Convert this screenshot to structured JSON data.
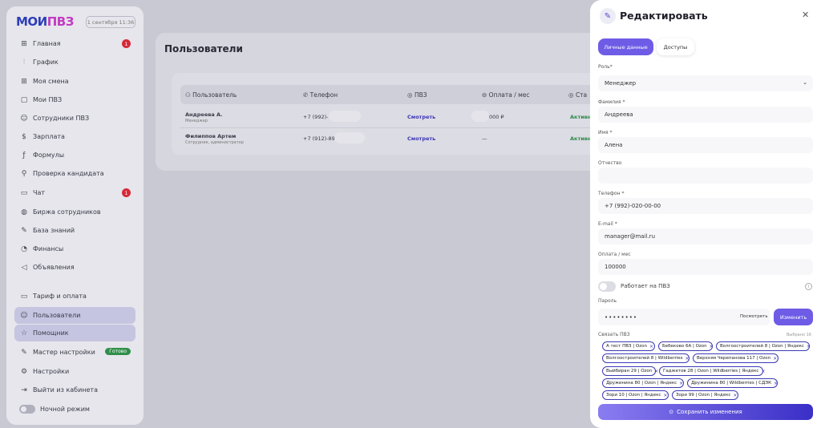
{
  "sidebar": {
    "logo_main": "МОИ",
    "logo_accent": "ПВЗ",
    "date": "1 сентября 11:36",
    "items": [
      {
        "label": "Главная",
        "icon": "grid-icon",
        "badge": "1"
      },
      {
        "label": "График",
        "icon": "chart-icon"
      },
      {
        "label": "Моя смена",
        "icon": "grid-icon"
      },
      {
        "label": "Мои ПВЗ",
        "icon": "box-icon"
      },
      {
        "label": "Сотрудники ПВЗ",
        "icon": "people-icon"
      },
      {
        "label": "Зарплата",
        "icon": "dollar-icon"
      },
      {
        "label": "Формулы",
        "icon": "function-icon"
      },
      {
        "label": "Проверка кандидата",
        "icon": "search-icon"
      },
      {
        "label": "Чат",
        "icon": "chat-icon",
        "badge": "1"
      },
      {
        "label": "Биржа сотрудников",
        "icon": "globe-icon"
      },
      {
        "label": "База знаний",
        "icon": "pen-icon"
      },
      {
        "label": "Финансы",
        "icon": "pie-icon"
      },
      {
        "label": "Объявления",
        "icon": "megaphone-icon"
      },
      {
        "label": "Тариф и оплата",
        "icon": "card-icon"
      },
      {
        "label": "Пользователи",
        "icon": "users-icon"
      },
      {
        "label": "Помощник",
        "icon": "star-icon"
      },
      {
        "label": "Мастер настройки",
        "icon": "wand-icon",
        "tag": "Готово"
      },
      {
        "label": "Настройки",
        "icon": "gear-icon"
      },
      {
        "label": "Выйти из кабинета",
        "icon": "logout-icon"
      },
      {
        "label": "Ночной режим",
        "icon": "toggle-icon"
      }
    ]
  },
  "main": {
    "title": "Пользователи",
    "columns": [
      "Пользователь",
      "Телефон",
      "ПВЗ",
      "Оплата / мес",
      "Ста"
    ],
    "rows": [
      {
        "name": "Андреева А.",
        "role": "Менеджер",
        "phone": "+7 (992)-",
        "pvz": "Смотреть",
        "pay": "000 ₽",
        "status": "Активна"
      },
      {
        "name": "Филиппов Артем",
        "role": "Сотрудник, администратор",
        "phone": "+7 (912)-891",
        "pvz": "Смотреть",
        "pay": "—",
        "status": "Активна"
      }
    ]
  },
  "panel": {
    "title": "Редактировать",
    "tabs": [
      "Личные данные",
      "Доступы"
    ],
    "role_label": "Роль*",
    "role_value": "Менеджер",
    "surname_label": "Фамилия *",
    "surname_value": "Андреева",
    "name_label": "Имя *",
    "name_value": "Алена",
    "patronymic_label": "Отчество",
    "patronymic_value": "",
    "phone_label": "Телефон *",
    "phone_value": "+7 (992)-020-00-00",
    "email_label": "E-mail *",
    "email_value": "manager@mail.ru",
    "pay_label": "Оплата / мес",
    "pay_value": "100000",
    "works_label": "Работает на ПВЗ",
    "password_label": "Пароль",
    "password_value": "••••••••",
    "show_label": "Посмотреть",
    "change_label": "Изменить",
    "link_label": "Связать ПВЗ",
    "chosen_label": "Выбрано 16",
    "chips": [
      "А тест ПВЗ | Ozon",
      "Бебеково 6А | Ozon",
      "Волгоостроителей 8 | Ozon | Яндекс",
      "Волгоостроителей 8 | Wildberries",
      "Верхняя Черепанова 117 | Ozon",
      "Выйбиран 29 | Ozon",
      "Гаджетов 28 | Ozon | Wildberries | Яндекс",
      "Дружинина 80 | Ozon | Яндекс",
      "Дружинина 80 | Wildberries | СДЭК",
      "Зори 10 | Ozon | Яндекс",
      "Зори 99 | Ozon | Яндекс"
    ],
    "save_label": "Сохранить изменения"
  }
}
